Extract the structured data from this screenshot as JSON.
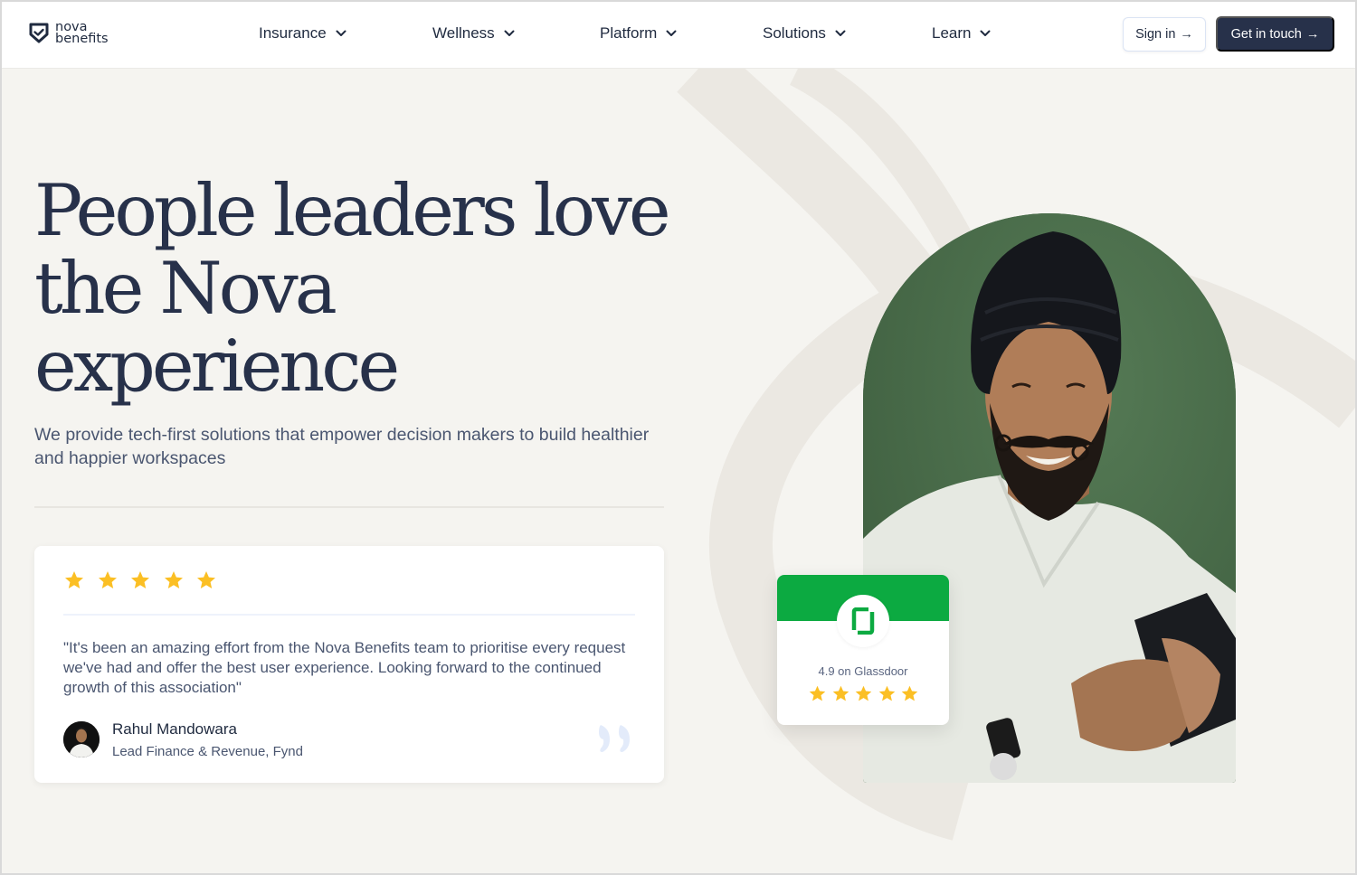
{
  "brand": {
    "logo_line1": "nova",
    "logo_line2": "benefits",
    "logo_icon": "shield-check-icon"
  },
  "nav": {
    "items": [
      {
        "label": "Insurance",
        "icon": "chevron-down-icon"
      },
      {
        "label": "Wellness",
        "icon": "chevron-down-icon"
      },
      {
        "label": "Platform",
        "icon": "chevron-down-icon"
      },
      {
        "label": "Solutions",
        "icon": "chevron-down-icon"
      },
      {
        "label": "Learn",
        "icon": "chevron-down-icon"
      }
    ],
    "sign_in": "Sign in",
    "get_in_touch": "Get in touch",
    "arrow": "→"
  },
  "hero": {
    "headline_line1": "People leaders love",
    "headline_line2": "the Nova",
    "headline_line3": "experience",
    "subtext": "We provide tech-first solutions that empower decision makers to build healthier and happier workspaces"
  },
  "testimonial": {
    "rating": 5,
    "rating_max": 5,
    "quote": "\"It's been an amazing effort from the Nova Benefits team to prioritise every request we've had and offer the best user experience. Looking forward to the continued growth of this association\"",
    "author_name": "Rahul Mandowara",
    "author_role": "Lead Finance & Revenue, Fynd"
  },
  "glassdoor": {
    "label": "4.9 on Glassdoor",
    "rating": 5,
    "rating_max": 5
  },
  "colors": {
    "primary_dark": "#27314a",
    "text": "#1f2a3f",
    "muted_text": "#4a5670",
    "background": "#f5f4f0",
    "star": "#fbbf24",
    "glassdoor_green": "#0caa41"
  }
}
